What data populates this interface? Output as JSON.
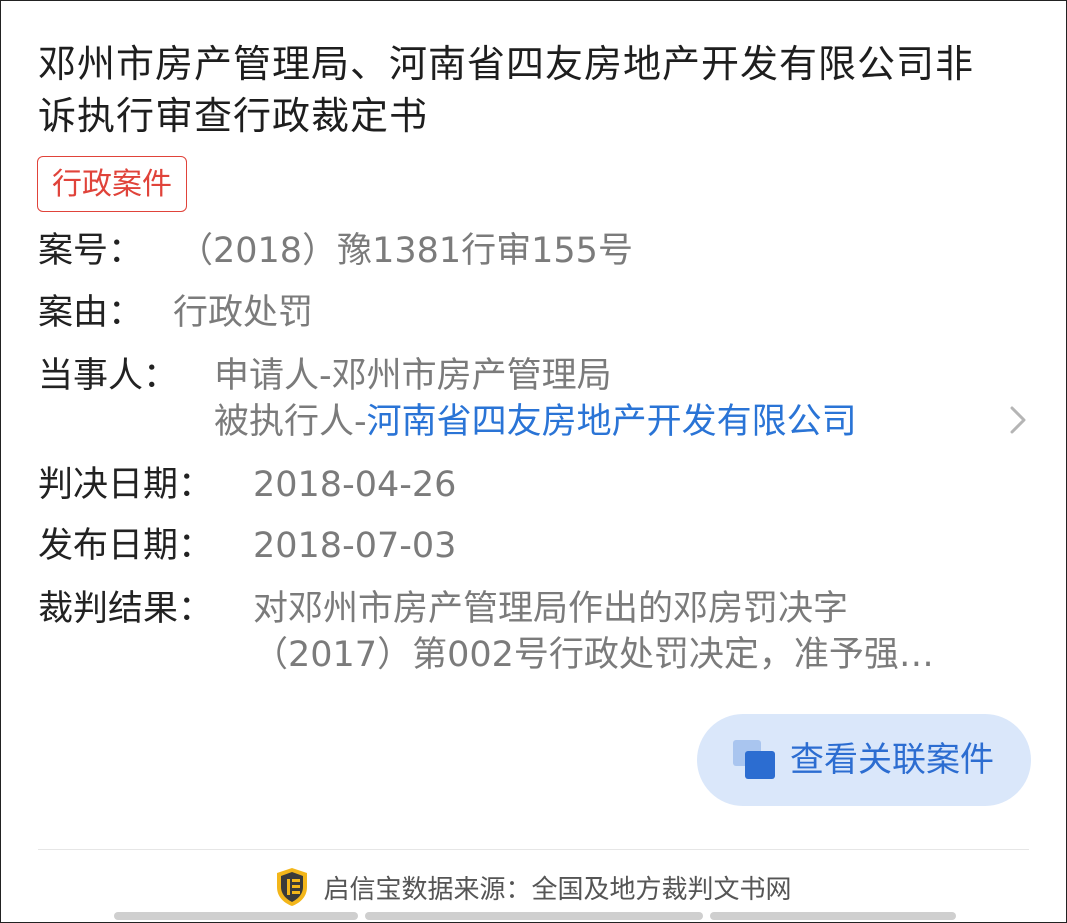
{
  "title": "邓州市房产管理局、河南省四友房地产开发有限公司非诉执行审查行政裁定书",
  "badge": "行政案件",
  "fields": {
    "case_no_label": "案号：",
    "case_no_value": "（2018）豫1381行审155号",
    "cause_label": "案由：",
    "cause_value": "行政处罚",
    "parties_label": "当事人：",
    "applicant": "申请人-邓州市房产管理局",
    "respondent_prefix": "被执行人-",
    "respondent_link": "河南省四友房地产开发有限公司",
    "judgment_date_label": "判决日期：",
    "judgment_date_value": "2018-04-26",
    "publish_date_label": "发布日期：",
    "publish_date_value": "2018-07-03",
    "result_label": "裁判结果：",
    "result_line1": "对邓州市房产管理局作出的邓房罚决字",
    "result_line2": "（2017）第002号行政处罚决定，准予强…"
  },
  "related_button": "查看关联案件",
  "footer": {
    "source_text": "启信宝数据来源：全国及地方裁判文书网"
  },
  "colors": {
    "badge": "#e0433a",
    "link": "#2a74d6",
    "button_bg": "#dae7fa",
    "button_text": "#2c6dd1"
  }
}
